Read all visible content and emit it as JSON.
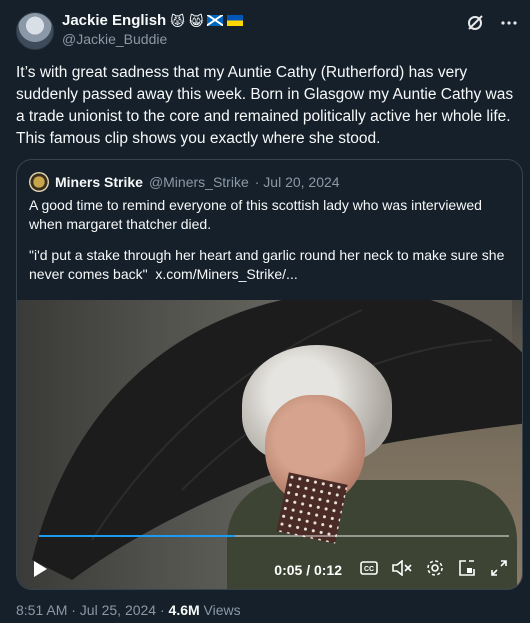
{
  "author": {
    "display_name": "Jackie English",
    "handle": "@Jackie_Buddie",
    "emojis": [
      "😾",
      "😸"
    ],
    "flags": [
      "scotland",
      "ukraine"
    ]
  },
  "tweet": {
    "text": "It’s with great sadness that my Auntie Cathy (Rutherford) has very suddenly passed away this week. Born in Glasgow my Auntie Cathy was a trade unionist to the core and remained politically active her whole life. This famous clip shows you exactly where she stood."
  },
  "quote": {
    "name": "Miners Strike",
    "handle": "@Miners_Strike",
    "date": "· Jul 20, 2024",
    "text_1": "A good time to remind everyone of this scottish lady who was interviewed when margaret thatcher died.",
    "text_2": "\"i'd put a stake through her heart and garlic round her neck to make sure she never comes back\"",
    "link": "x.com/Miners_Strike/..."
  },
  "video": {
    "time": "0:05 / 0:12",
    "progress": 0.417,
    "icons": [
      "play-icon",
      "captions-icon",
      "mute-icon",
      "settings-icon",
      "pip-icon",
      "fullscreen-icon"
    ]
  },
  "footer": {
    "time_date": "8:51 AM · Jul 25, 2024 · ",
    "views_count": "4.6M",
    "views_label": " Views"
  },
  "colors": {
    "background": "#15202b",
    "text": "#f7f9f9",
    "secondary": "#8b98a5",
    "accent": "#1d9bf0",
    "border": "#38444d"
  }
}
